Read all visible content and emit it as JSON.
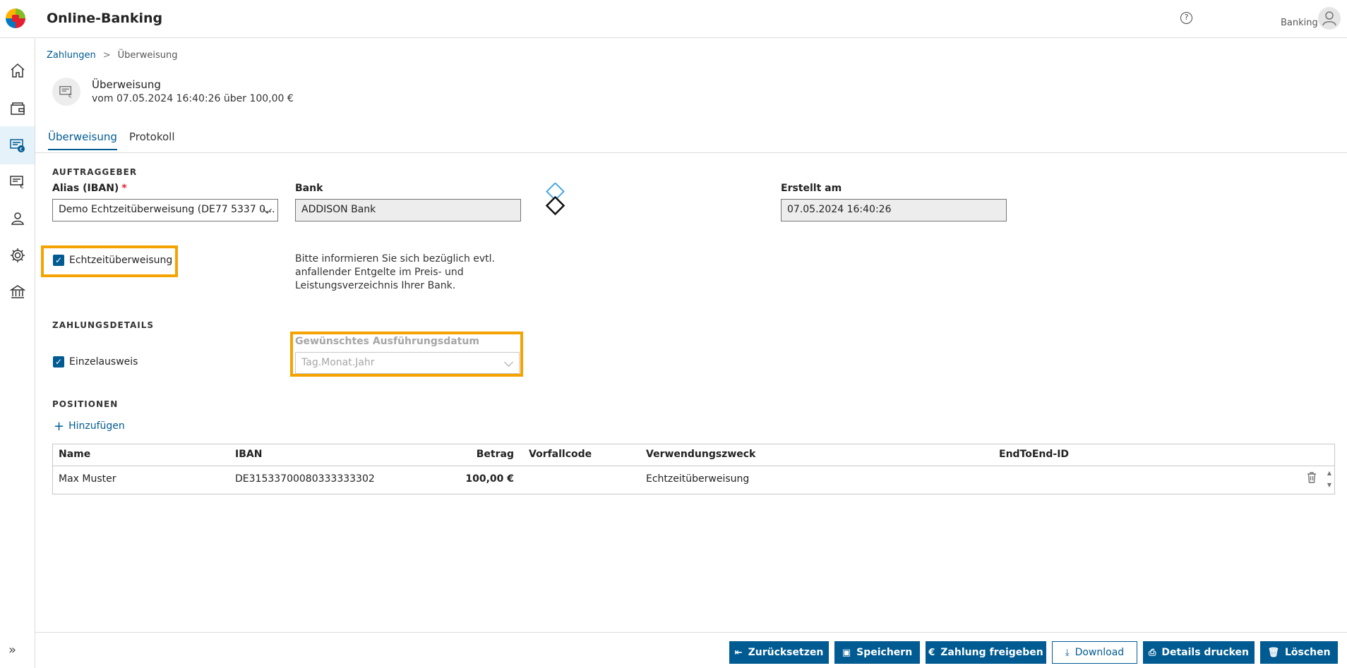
{
  "app": {
    "title": "Online-Banking",
    "user_label": "Banking",
    "help_glyph": "?"
  },
  "sidebar": {
    "items": [
      {
        "name": "home-icon"
      },
      {
        "name": "wallet-icon"
      },
      {
        "name": "payment-transfer-icon",
        "active": true
      },
      {
        "name": "invoice-icon"
      },
      {
        "name": "person-icon"
      },
      {
        "name": "gear-icon"
      },
      {
        "name": "bank-icon"
      }
    ],
    "expand_glyph": "»"
  },
  "breadcrumb": {
    "parent": "Zahlungen",
    "separator": ">",
    "current": "Überweisung"
  },
  "document": {
    "title": "Überweisung",
    "subtitle": "vom 07.05.2024 16:40:26 über 100,00 €"
  },
  "tabs": [
    {
      "label": "Überweisung",
      "active": true
    },
    {
      "label": "Protokoll",
      "active": false
    }
  ],
  "auftraggeber": {
    "section": "AUFTRAGGEBER",
    "alias_label": "Alias (IBAN)",
    "required_mark": "*",
    "alias_value": "Demo Echtzeitüberweisung (DE77 5337 0...",
    "bank_label": "Bank",
    "bank_value": "ADDISON Bank",
    "created_label": "Erstellt am",
    "created_value": "07.05.2024 16:40:26"
  },
  "instant": {
    "checked": true,
    "label": "Echtzeitüberweisung",
    "info": "Bitte informieren Sie sich bezüglich evtl. anfallender Entgelte im Preis- und Leistungsverzeichnis Ihrer Bank."
  },
  "zahlungsdetails": {
    "section": "ZAHLUNGSDETAILS",
    "single_label": "Einzelausweis",
    "single_checked": true,
    "date_label": "Gewünschtes Ausführungsdatum",
    "date_placeholder": "Tag.Monat.Jahr"
  },
  "positionen": {
    "section": "POSITIONEN",
    "add_label": "Hinzufügen",
    "columns": [
      "Name",
      "IBAN",
      "Betrag",
      "Vorfallcode",
      "Verwendungszweck",
      "EndToEnd-ID"
    ],
    "rows": [
      {
        "name": "Max Muster",
        "iban": "DE31533700080333333302",
        "amount": "100,00 €",
        "code": "",
        "purpose": "Echtzeitüberweisung",
        "e2e": ""
      }
    ]
  },
  "footer": {
    "reset": "Zurücksetzen",
    "save": "Speichern",
    "release": "Zahlung freigeben",
    "download": "Download",
    "print": "Details drucken",
    "delete": "Löschen"
  },
  "colors": {
    "accent": "#005b92",
    "highlight": "#f5a300",
    "required": "#e5202e"
  }
}
